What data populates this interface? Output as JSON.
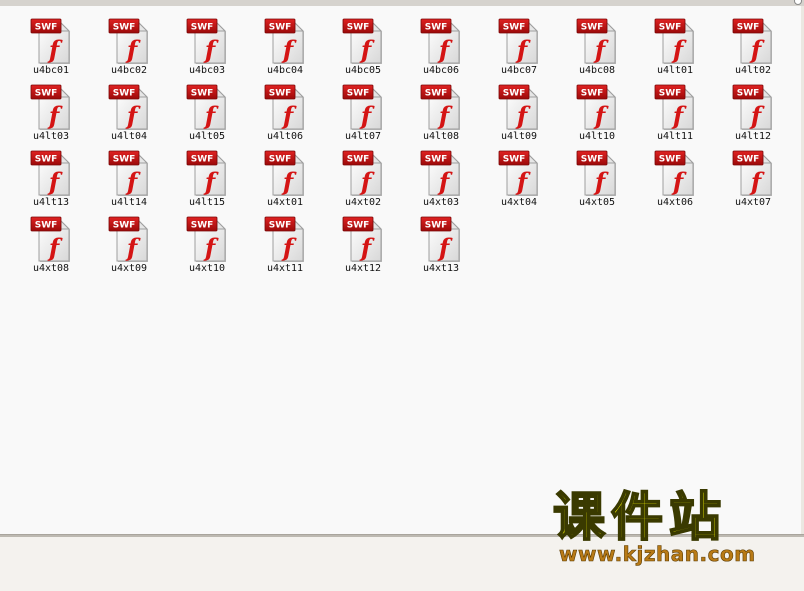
{
  "files": [
    "u4bc01",
    "u4bc02",
    "u4bc03",
    "u4bc04",
    "u4bc05",
    "u4bc06",
    "u4bc07",
    "u4bc08",
    "u4lt01",
    "u4lt02",
    "u4lt03",
    "u4lt04",
    "u4lt05",
    "u4lt06",
    "u4lt07",
    "u4lt08",
    "u4lt09",
    "u4lt10",
    "u4lt11",
    "u4lt12",
    "u4lt13",
    "u4lt14",
    "u4lt15",
    "u4xt01",
    "u4xt02",
    "u4xt03",
    "u4xt04",
    "u4xt05",
    "u4xt06",
    "u4xt07",
    "u4xt08",
    "u4xt09",
    "u4xt10",
    "u4xt11",
    "u4xt12",
    "u4xt13"
  ],
  "icon": {
    "name": "swf-file-icon",
    "badge_text": "SWF",
    "glyph": "f"
  },
  "colors": {
    "badge_red": "#c40e0e",
    "glyph_red": "#d41414",
    "pane_bg": "#f9f9f9",
    "watermark_yellow": "#ffff00",
    "watermark_url": "#b87a16"
  },
  "watermark": {
    "title": "课件站",
    "url": "www.kjzhan.com"
  }
}
